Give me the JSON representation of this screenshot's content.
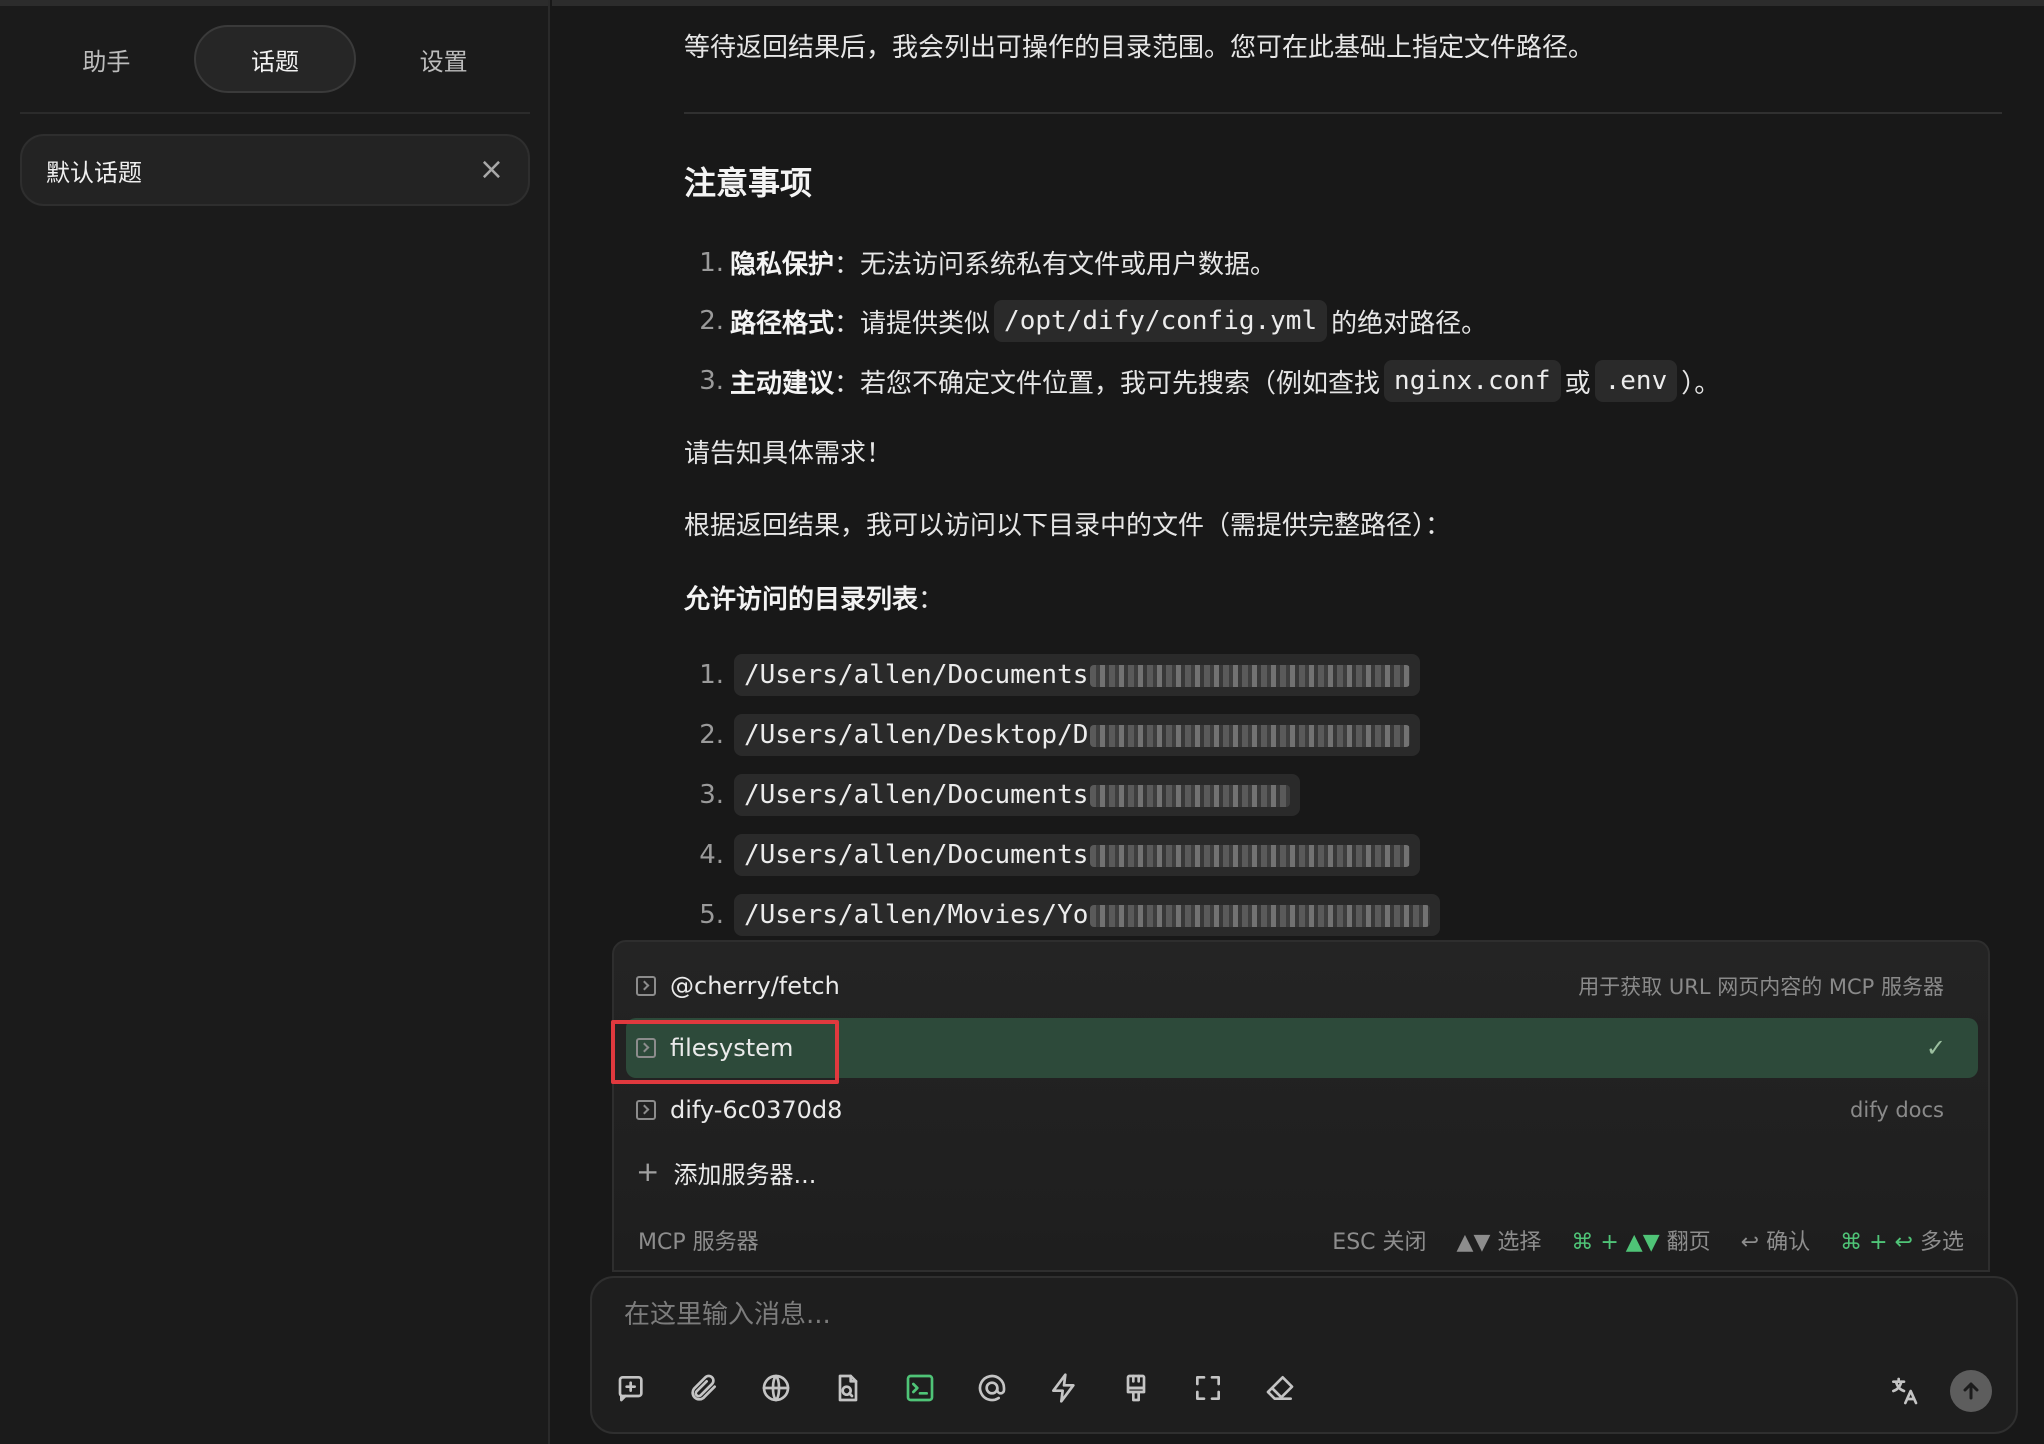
{
  "sidebar": {
    "tabs": [
      {
        "label": "助手",
        "active": false
      },
      {
        "label": "话题",
        "active": true
      },
      {
        "label": "设置",
        "active": false
      }
    ],
    "topic": {
      "label": "默认话题",
      "close_icon": "×"
    }
  },
  "chat": {
    "intro": "等待返回结果后，我会列出可操作的目录范围。您可在此基础上指定文件路径。",
    "notice_heading": "注意事项",
    "notices": [
      {
        "num": "1.",
        "title": "隐私保护",
        "sep": "：",
        "text": "无法访问系统私有文件或用户数据。"
      },
      {
        "num": "2.",
        "title": "路径格式",
        "sep": "：",
        "pre": "请提供类似",
        "code": "/opt/dify/config.yml",
        "post": "的绝对路径。"
      },
      {
        "num": "3.",
        "title": "主动建议",
        "sep": "：",
        "pre": "若您不确定文件位置，我可先搜索（例如查找",
        "code1": "nginx.conf",
        "mid": "或",
        "code2": ".env",
        "post": "）。"
      }
    ],
    "ask": "请告知具体需求！",
    "result_intro": "根据返回结果，我可以访问以下目录中的文件（需提供完整路径）：",
    "allowed_heading": "允许访问的目录列表",
    "allowed_sep": "：",
    "dirs": [
      {
        "num": "1.",
        "path": "/Users/allen/Documents",
        "blur_hint": "redacted"
      },
      {
        "num": "2.",
        "path": "/Users/allen/Desktop/D",
        "blur_hint": "redacted"
      },
      {
        "num": "3.",
        "path": "/Users/allen/Documents",
        "blur_hint": "redacted"
      },
      {
        "num": "4.",
        "path": "/Users/allen/Documents",
        "blur_hint": "redacted"
      },
      {
        "num": "5.",
        "path": "/Users/allen/Movies/Yo",
        "blur_hint": "redacted"
      }
    ]
  },
  "mcp_popup": {
    "items": [
      {
        "name": "@cherry/fetch",
        "desc": "用于获取 URL 网页内容的 MCP 服务器",
        "icon": "terminal-icon",
        "selected": false
      },
      {
        "name": "filesystem",
        "desc": "",
        "icon": "terminal-icon",
        "selected": true,
        "check": "✓"
      },
      {
        "name": "dify-6c0370d8",
        "desc": "dify docs",
        "icon": "terminal-icon",
        "selected": false
      }
    ],
    "add_label": "添加服务器...",
    "add_icon": "+",
    "footer_title": "MCP 服务器",
    "hints": {
      "esc": "ESC 关闭",
      "select_keys": "▲▼",
      "select": "选择",
      "page_keys": "⌘ + ▲▼",
      "page": "翻页",
      "confirm_key": "↩",
      "confirm": "确认",
      "multi_keys": "⌘ + ↩",
      "multi": "多选"
    },
    "highlight_color": "#e0393e",
    "selected_bg": "#2d4a3a"
  },
  "composer": {
    "placeholder": "在这里输入消息...",
    "tools": [
      "new-topic-icon",
      "attachment-icon",
      "web-search-icon",
      "knowledge-icon",
      "mcp-tools-icon",
      "mention-icon",
      "quick-phrase-icon",
      "clear-context-icon",
      "fullscreen-icon",
      "eraser-icon"
    ],
    "right_tools": [
      "translate-icon",
      "send-icon"
    ]
  }
}
